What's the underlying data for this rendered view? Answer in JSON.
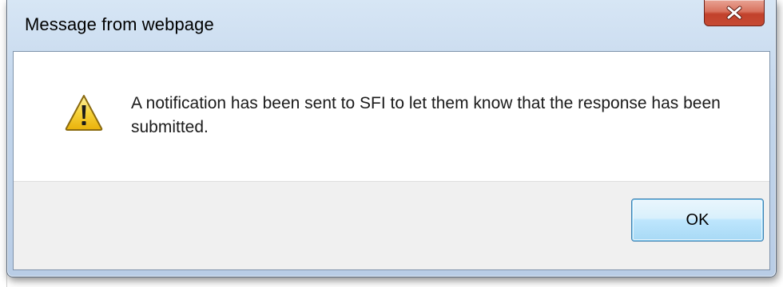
{
  "dialog": {
    "title": "Message from webpage",
    "message": "A notification has been sent to SFI to let them know that the response has been submitted.",
    "icon": "warning-icon",
    "close_icon": "close-icon",
    "ok_label": "OK"
  },
  "colors": {
    "title_bar": "#c3d6ec",
    "close_button": "#c64a33",
    "button_area": "#f0f0f0",
    "ok_button": "#bee6fd",
    "warning_yellow": "#f2c21a"
  }
}
